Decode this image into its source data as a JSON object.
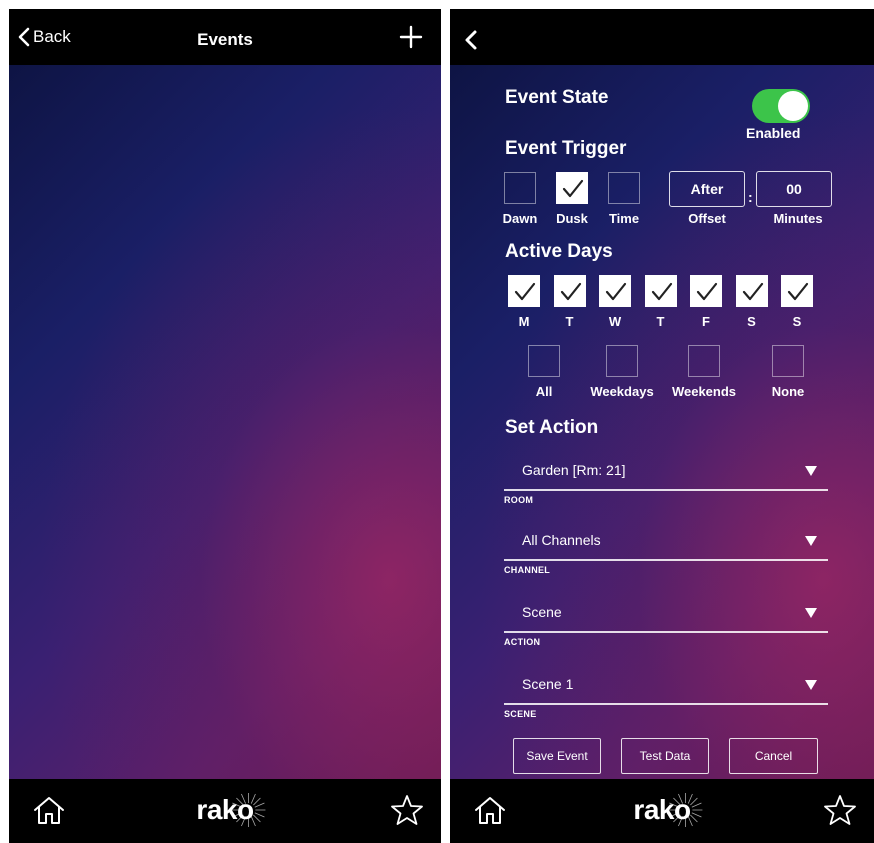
{
  "left": {
    "back_label": "Back",
    "title": "Events",
    "add_icon": "plus-icon"
  },
  "right": {
    "back_icon": "chevron-left-icon",
    "event_state": {
      "heading": "Event State",
      "toggle_on": true,
      "toggle_label": "Enabled"
    },
    "event_trigger": {
      "heading": "Event Trigger",
      "options": [
        {
          "label": "Dawn",
          "checked": false
        },
        {
          "label": "Dusk",
          "checked": true
        },
        {
          "label": "Time",
          "checked": false
        }
      ],
      "offset_value": "After",
      "offset_label": "Offset",
      "separator": ":",
      "minutes_value": "00",
      "minutes_label": "Minutes"
    },
    "active_days": {
      "heading": "Active Days",
      "days": [
        {
          "label": "M",
          "checked": true
        },
        {
          "label": "T",
          "checked": true
        },
        {
          "label": "W",
          "checked": true
        },
        {
          "label": "T",
          "checked": true
        },
        {
          "label": "F",
          "checked": true
        },
        {
          "label": "S",
          "checked": true
        },
        {
          "label": "S",
          "checked": true
        }
      ],
      "presets": [
        {
          "label": "All",
          "checked": false
        },
        {
          "label": "Weekdays",
          "checked": false
        },
        {
          "label": "Weekends",
          "checked": false
        },
        {
          "label": "None",
          "checked": false
        }
      ]
    },
    "set_action": {
      "heading": "Set Action",
      "fields": [
        {
          "value": "Garden [Rm: 21]",
          "label": "ROOM"
        },
        {
          "value": "All Channels",
          "label": "CHANNEL"
        },
        {
          "value": "Scene",
          "label": "ACTION"
        },
        {
          "value": "Scene 1",
          "label": "SCENE"
        }
      ]
    },
    "buttons": {
      "save": "Save Event",
      "test": "Test Data",
      "cancel": "Cancel"
    }
  },
  "footer": {
    "logo_text": "rako",
    "home_icon": "home-icon",
    "favorite_icon": "star-icon"
  },
  "colors": {
    "bar": "#000000",
    "toggle_on": "#3cc44a",
    "bg_top": "#0e1444",
    "bg_bottom": "#6a1c55"
  }
}
